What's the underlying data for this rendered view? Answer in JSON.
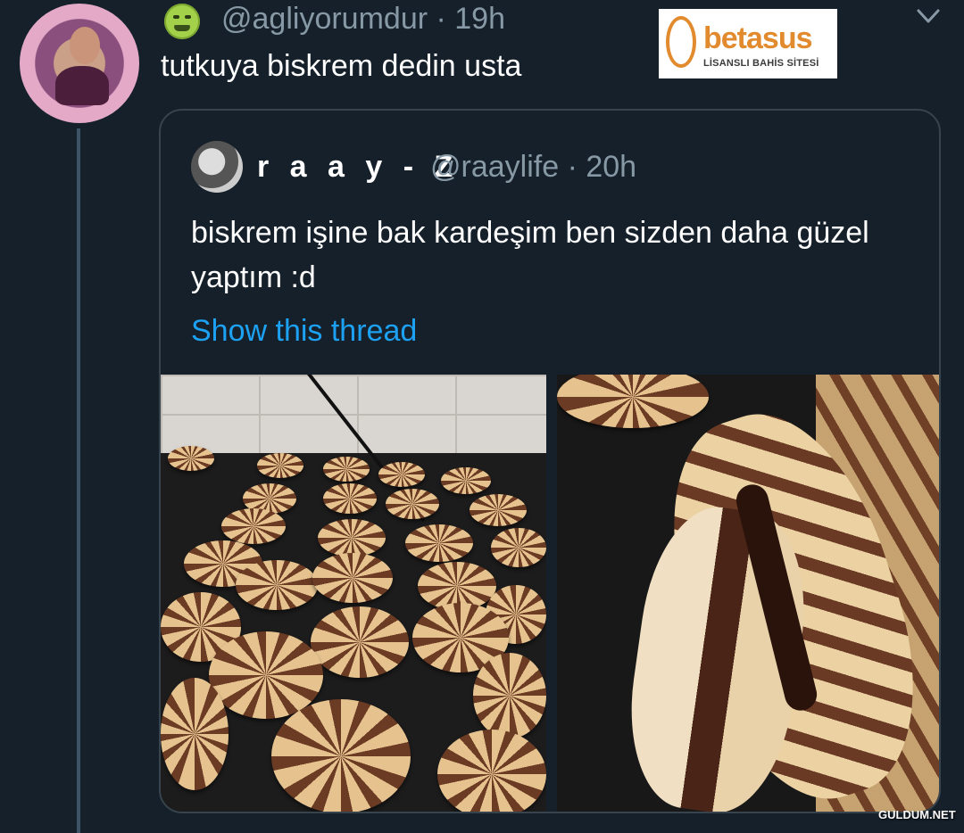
{
  "tweet": {
    "handle_line": "@agliyorumdur · 19h",
    "text": "tutkuya biskrem dedin usta",
    "emoji": "nauseated-face"
  },
  "ad": {
    "brand": "betasus",
    "tagline": "LİSANSLI BAHİS SİTESİ",
    "accent": "#e28a2e"
  },
  "quoted": {
    "name": "r a a y - Z",
    "handle_line": "@raaylife · 20h",
    "text": "biskrem işine bak kardeşim ben sizden daha güzel yaptım :d",
    "show_thread": "Show this thread"
  },
  "watermark": "GULDUM.NET",
  "colors": {
    "background": "#15202b",
    "link": "#1da1f2",
    "secondary_text": "#8899a6",
    "border": "#38444d"
  }
}
